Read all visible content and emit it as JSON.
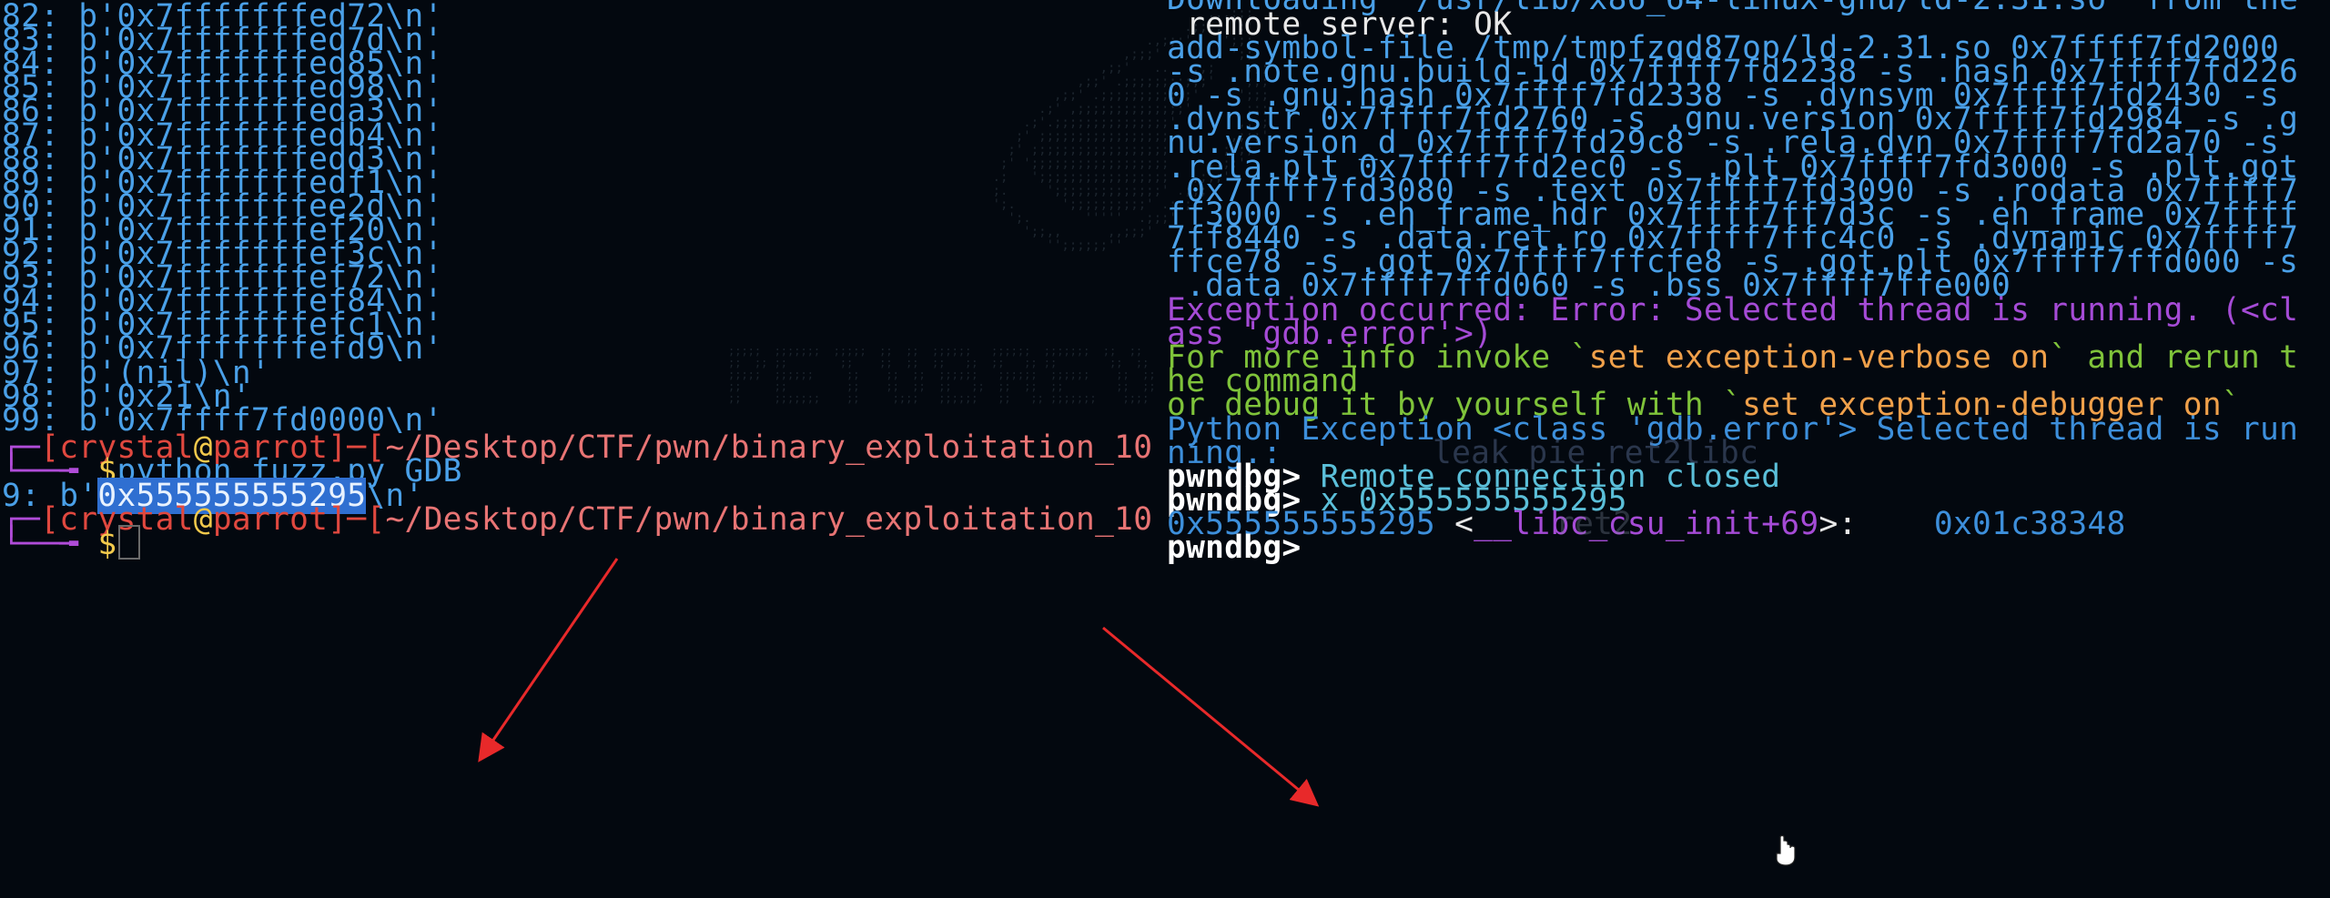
{
  "left_pane": {
    "leak_lines": [
      {
        "n": "82:",
        "v": "b'0x7fffffffed72\\n'"
      },
      {
        "n": "83:",
        "v": "b'0x7fffffffed7d\\n'"
      },
      {
        "n": "84:",
        "v": "b'0x7fffffffed85\\n'"
      },
      {
        "n": "85:",
        "v": "b'0x7fffffffed98\\n'"
      },
      {
        "n": "86:",
        "v": "b'0x7fffffffeda3\\n'"
      },
      {
        "n": "87:",
        "v": "b'0x7fffffffedb4\\n'"
      },
      {
        "n": "88:",
        "v": "b'0x7fffffffedd3\\n'"
      },
      {
        "n": "89:",
        "v": "b'0x7fffffffedf1\\n'"
      },
      {
        "n": "90:",
        "v": "b'0x7fffffffee2d\\n'"
      },
      {
        "n": "91:",
        "v": "b'0x7fffffffef20\\n'"
      },
      {
        "n": "92:",
        "v": "b'0x7fffffffef3c\\n'"
      },
      {
        "n": "93:",
        "v": "b'0x7fffffffef72\\n'"
      },
      {
        "n": "94:",
        "v": "b'0x7fffffffef84\\n'"
      },
      {
        "n": "95:",
        "v": "b'0x7fffffffefc1\\n'"
      },
      {
        "n": "96:",
        "v": "b'0x7fffffffefd9\\n'"
      },
      {
        "n": "97:",
        "v": "b'(nil)\\n'"
      },
      {
        "n": "98:",
        "v": "b'0x21\\n'"
      },
      {
        "n": "99:",
        "v": "b'0x7ffff7fd0000\\n'"
      }
    ],
    "prompt1": {
      "box_top": "┌─",
      "open": "[",
      "user": "crystal",
      "at": "@",
      "host": "parrot",
      "close_dash": "]─[",
      "path": "~/Desktop/CTF/pwn/binary_exploitation_10",
      "box_bottom": "└──╼ ",
      "dollar": "$",
      "command": "python fuzz.py GDB"
    },
    "result": {
      "prefix": "9: b'",
      "highlighted": "0x555555555295",
      "suffix": "\\n'"
    },
    "prompt2": {
      "box_top": "┌─",
      "open": "[",
      "user": "crystal",
      "at": "@",
      "host": "parrot",
      "close_dash": "]─[",
      "path": "~/Desktop/CTF/pwn/binary_exploitation_10",
      "box_bottom": "└──╼ ",
      "dollar": "$"
    }
  },
  "right_pane": {
    "top_partial": "Downloading '/usr/lib/x86_64-linux-gnu/ld-2.31.so' from the",
    "remote_ok": " remote server: OK",
    "symbol_lines": [
      "add-symbol-file /tmp/tmpfzqd87op/ld-2.31.so 0x7ffff7fd2000",
      "-s .note.gnu.build-id 0x7ffff7fd2238 -s .hash 0x7ffff7fd226",
      "0 -s .gnu.hash 0x7ffff7fd2338 -s .dynsym 0x7ffff7fd2430 -s",
      ".dynstr 0x7ffff7fd2760 -s .gnu.version 0x7ffff7fd2984 -s .g",
      "nu.version_d 0x7ffff7fd29c8 -s .rela.dyn 0x7ffff7fd2a70 -s",
      ".rela.plt 0x7ffff7fd2ec0 -s .plt 0x7ffff7fd3000 -s .plt.got",
      " 0x7ffff7fd3080 -s .text 0x7ffff7fd3090 -s .rodata 0x7ffff7",
      "ff3000 -s .eh_frame_hdr 0x7ffff7ff7d3c -s .eh_frame 0x7ffff",
      "7ff8440 -s .data.rel.ro 0x7ffff7ffc4c0 -s .dynamic 0x7ffff7",
      "ffce78 -s .got 0x7ffff7ffcfe8 -s .got.plt 0x7ffff7ffd000 -s",
      " .data 0x7ffff7ffd060 -s .bss 0x7ffff7ffe000"
    ],
    "exception_lines": [
      "Exception occurred: Error: Selected thread is running. (<cl",
      "ass 'gdb.error'>)"
    ],
    "more_info": {
      "a": "For more info invoke `",
      "b": "set exception-verbose on",
      "c": "` and rerun t",
      "d": "he command"
    },
    "debug_it": {
      "a": "or debug it by yourself with `",
      "b": "set exception-debugger on",
      "c": "`"
    },
    "python_exc": [
      "Python Exception <class 'gdb.error'> Selected thread is run",
      "ning.: "
    ],
    "ghost_overlap_1": "leak_pie_ret2libc",
    "pwndbg_prompt": "pwndbg>",
    "remote_closed": " Remote connection closed",
    "x_cmd": " x 0x555555555295",
    "x_result": {
      "addr": "0x555555555295",
      "sym_open": " <",
      "sym": "__libc_csu_init",
      "offset": "+69",
      "sym_close": ">:",
      "value": "    0x01c38348"
    },
    "ghost_overlap_2": "ret2",
    "last_prompt": "pwndbg>"
  },
  "colors": {
    "background": "#03080f",
    "blue_text": "#4aa0e8",
    "prompt_red": "#e0483f",
    "highlight": "#2f6fd1",
    "purple": "#a54bd6",
    "green": "#7fc33a",
    "orange": "#f0a04a",
    "annotation_arrow": "#e8292a"
  },
  "icons": {
    "mouse": "mouse-pointer-icon",
    "arrows": "annotation-arrow"
  }
}
